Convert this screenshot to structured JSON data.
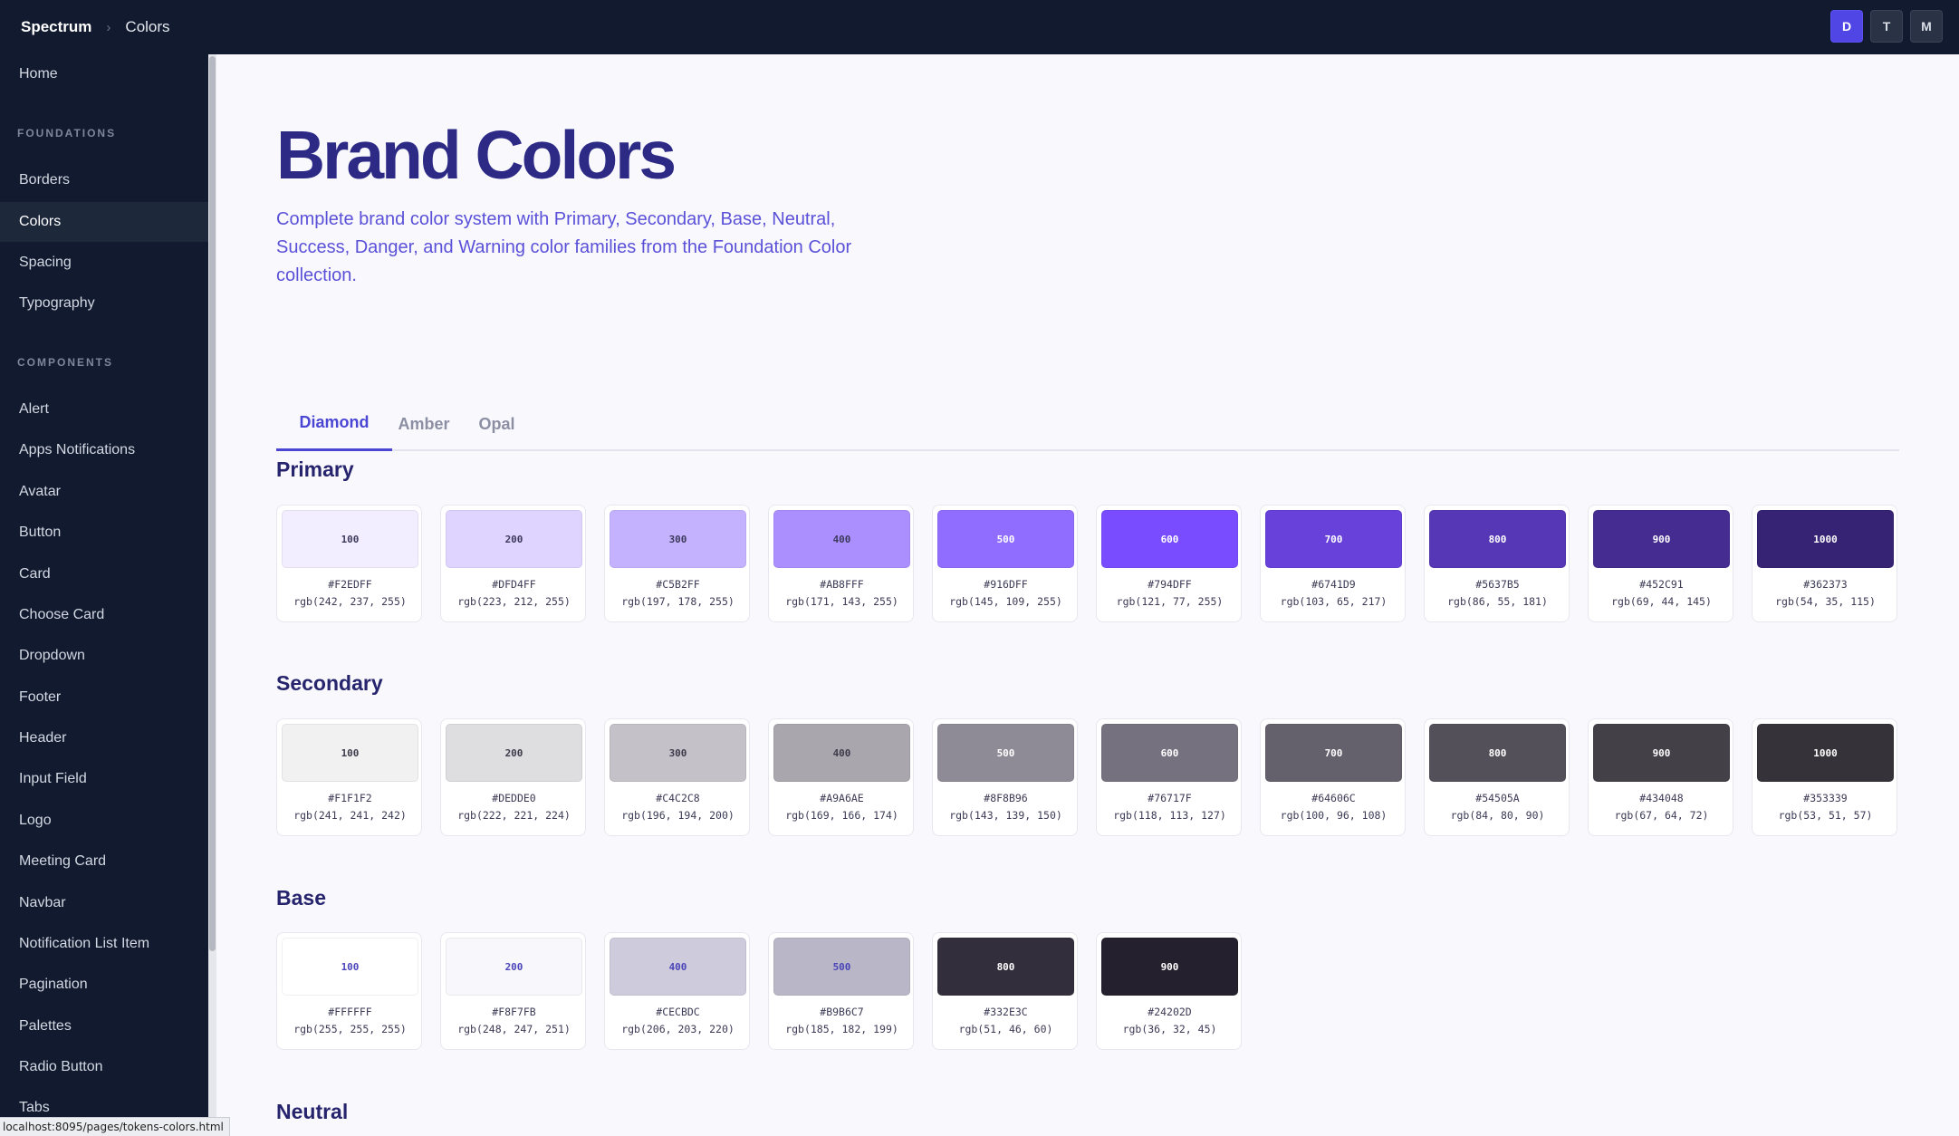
{
  "topbar": {
    "brand": "Spectrum",
    "separator": "›",
    "current_page": "Colors",
    "theme_buttons": [
      {
        "label": "D",
        "active": true
      },
      {
        "label": "T",
        "active": false
      },
      {
        "label": "M",
        "active": false
      }
    ]
  },
  "sidebar": {
    "home": "Home",
    "sections": [
      {
        "title": "FOUNDATIONS",
        "items": [
          "Borders",
          "Colors",
          "Spacing",
          "Typography"
        ]
      },
      {
        "title": "COMPONENTS",
        "items": [
          "Alert",
          "Apps Notifications",
          "Avatar",
          "Button",
          "Card",
          "Choose Card",
          "Dropdown",
          "Footer",
          "Header",
          "Input Field",
          "Logo",
          "Meeting Card",
          "Navbar",
          "Notification List Item",
          "Pagination",
          "Palettes",
          "Radio Button",
          "Tabs"
        ]
      }
    ],
    "active_item": "Colors"
  },
  "page": {
    "title": "Brand Colors",
    "description": "Complete brand color system with Primary, Secondary, Base, Neutral, Success, Danger, and Warning color families from the Foundation Color collection."
  },
  "tabs": [
    {
      "label": "Diamond",
      "active": true
    },
    {
      "label": "Amber",
      "active": false
    },
    {
      "label": "Opal",
      "active": false
    }
  ],
  "palettes": [
    {
      "name": "Primary",
      "swatches": [
        {
          "step": "100",
          "hex": "#F2EDFF",
          "rgb": "rgb(242, 237, 255)",
          "label_color": "#3d3a5c"
        },
        {
          "step": "200",
          "hex": "#DFD4FF",
          "rgb": "rgb(223, 212, 255)",
          "label_color": "#3d3a5c"
        },
        {
          "step": "300",
          "hex": "#C5B2FF",
          "rgb": "rgb(197, 178, 255)",
          "label_color": "#3d3a5c"
        },
        {
          "step": "400",
          "hex": "#AB8FFF",
          "rgb": "rgb(171, 143, 255)",
          "label_color": "#3d3a5c"
        },
        {
          "step": "500",
          "hex": "#916DFF",
          "rgb": "rgb(145, 109, 255)",
          "label_color": "#ffffff"
        },
        {
          "step": "600",
          "hex": "#794DFF",
          "rgb": "rgb(121, 77, 255)",
          "label_color": "#ffffff"
        },
        {
          "step": "700",
          "hex": "#6741D9",
          "rgb": "rgb(103, 65, 217)",
          "label_color": "#ffffff"
        },
        {
          "step": "800",
          "hex": "#5637B5",
          "rgb": "rgb(86, 55, 181)",
          "label_color": "#ffffff"
        },
        {
          "step": "900",
          "hex": "#452C91",
          "rgb": "rgb(69, 44, 145)",
          "label_color": "#ffffff"
        },
        {
          "step": "1000",
          "hex": "#362373",
          "rgb": "rgb(54, 35, 115)",
          "label_color": "#ffffff"
        }
      ]
    },
    {
      "name": "Secondary",
      "swatches": [
        {
          "step": "100",
          "hex": "#F1F1F2",
          "rgb": "rgb(241, 241, 242)",
          "label_color": "#3d3a4a"
        },
        {
          "step": "200",
          "hex": "#DEDDE0",
          "rgb": "rgb(222, 221, 224)",
          "label_color": "#3d3a4a"
        },
        {
          "step": "300",
          "hex": "#C4C2C8",
          "rgb": "rgb(196, 194, 200)",
          "label_color": "#3d3a4a"
        },
        {
          "step": "400",
          "hex": "#A9A6AE",
          "rgb": "rgb(169, 166, 174)",
          "label_color": "#3d3a4a"
        },
        {
          "step": "500",
          "hex": "#8F8B96",
          "rgb": "rgb(143, 139, 150)",
          "label_color": "#ffffff"
        },
        {
          "step": "600",
          "hex": "#76717F",
          "rgb": "rgb(118, 113, 127)",
          "label_color": "#ffffff"
        },
        {
          "step": "700",
          "hex": "#64606C",
          "rgb": "rgb(100, 96, 108)",
          "label_color": "#ffffff"
        },
        {
          "step": "800",
          "hex": "#54505A",
          "rgb": "rgb(84, 80, 90)",
          "label_color": "#ffffff"
        },
        {
          "step": "900",
          "hex": "#434048",
          "rgb": "rgb(67, 64, 72)",
          "label_color": "#ffffff"
        },
        {
          "step": "1000",
          "hex": "#353339",
          "rgb": "rgb(53, 51, 57)",
          "label_color": "#ffffff"
        }
      ]
    },
    {
      "name": "Base",
      "swatches": [
        {
          "step": "100",
          "hex": "#FFFFFF",
          "rgb": "rgb(255, 255, 255)",
          "label_color": "#4a45b8"
        },
        {
          "step": "200",
          "hex": "#F8F7FB",
          "rgb": "rgb(248, 247, 251)",
          "label_color": "#4a45b8"
        },
        {
          "step": "400",
          "hex": "#CECBDC",
          "rgb": "rgb(206, 203, 220)",
          "label_color": "#4a45b8"
        },
        {
          "step": "500",
          "hex": "#B9B6C7",
          "rgb": "rgb(185, 182, 199)",
          "label_color": "#4a45b8"
        },
        {
          "step": "800",
          "hex": "#332E3C",
          "rgb": "rgb(51, 46, 60)",
          "label_color": "#ffffff"
        },
        {
          "step": "900",
          "hex": "#24202D",
          "rgb": "rgb(36, 32, 45)",
          "label_color": "#ffffff"
        }
      ]
    },
    {
      "name": "Neutral",
      "swatches": []
    }
  ],
  "status_bar": {
    "url": "localhost:8095/pages/tokens-colors.html"
  }
}
